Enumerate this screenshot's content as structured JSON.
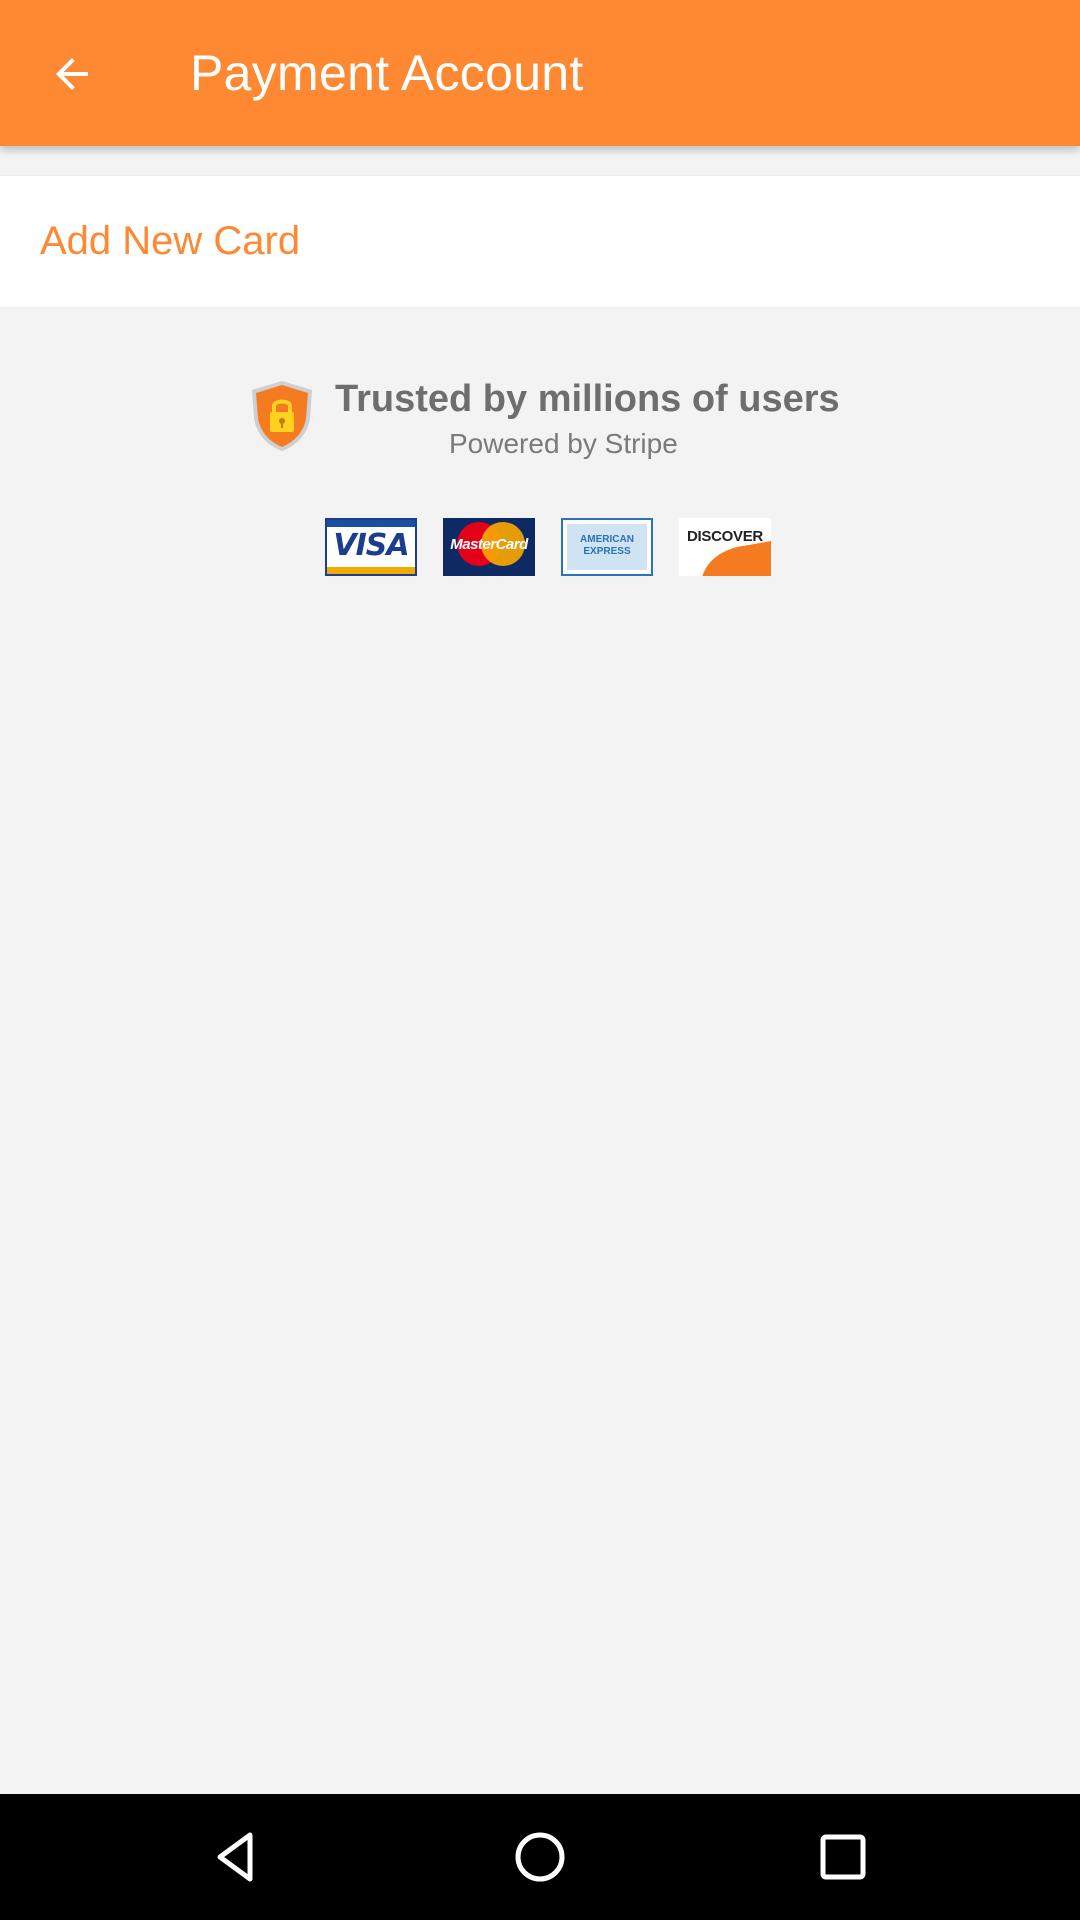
{
  "app_bar": {
    "title": "Payment Account",
    "background_color": "#ff8833",
    "back_icon": "arrow-back-icon"
  },
  "payment": {
    "add_card_label": "Add New Card",
    "accent_color": "#ff8833"
  },
  "trust_badge": {
    "icon": "shield-lock-icon",
    "title": "Trusted by millions of users",
    "subtitle": "Powered by Stripe"
  },
  "accepted_cards": [
    {
      "name": "visa-logo",
      "label": "VISA"
    },
    {
      "name": "mastercard-logo",
      "label": "MasterCard"
    },
    {
      "name": "american-express-logo",
      "label": "AMERICAN EXPRESS"
    },
    {
      "name": "discover-logo",
      "label": "DISCOVER"
    }
  ],
  "navigation_bar": {
    "back_icon": "nav-back-triangle-icon",
    "home_icon": "nav-home-circle-icon",
    "recents_icon": "nav-recents-square-icon"
  }
}
